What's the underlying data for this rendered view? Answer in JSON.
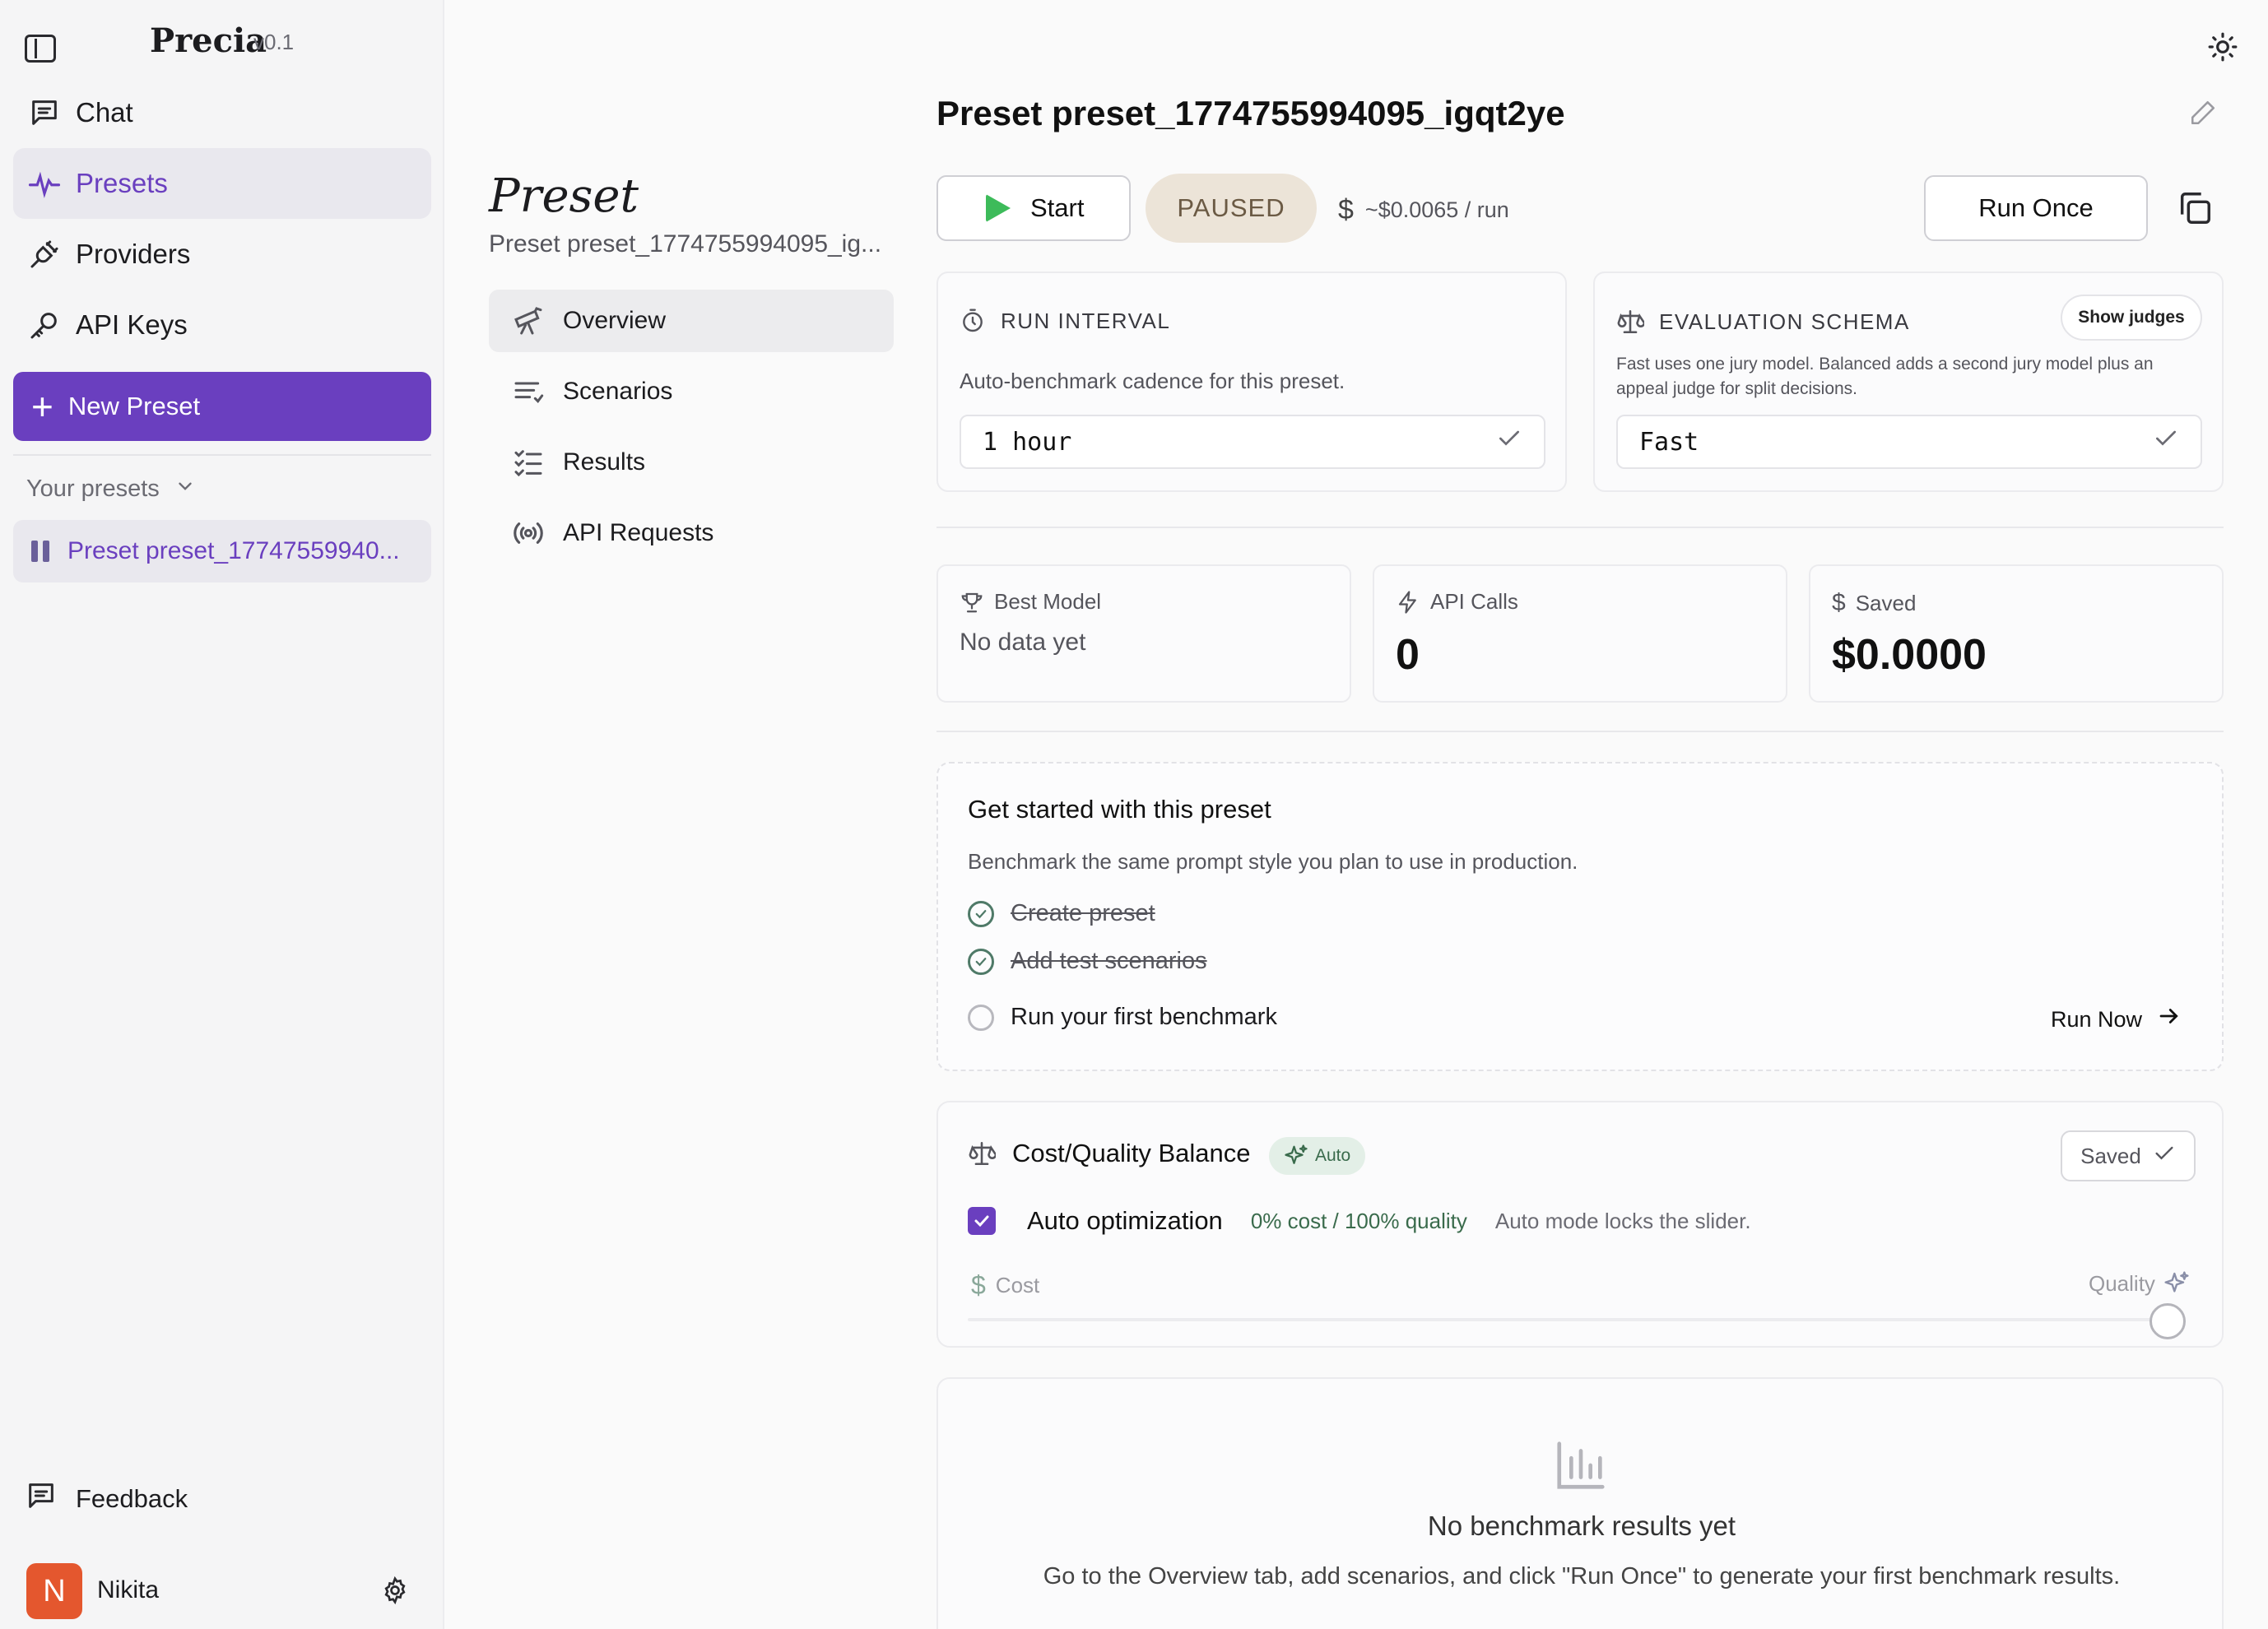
{
  "app": {
    "name": "Precia",
    "version": "v0.1"
  },
  "sidebar": {
    "nav": [
      {
        "label": "Chat",
        "icon": "chat-icon"
      },
      {
        "label": "Presets",
        "icon": "presets-icon",
        "active": true
      },
      {
        "label": "Providers",
        "icon": "plug-icon"
      },
      {
        "label": "API Keys",
        "icon": "key-icon"
      }
    ],
    "new_preset_label": "New Preset",
    "your_presets_label": "Your presets",
    "presets": [
      {
        "label": "Preset preset_17747559940..."
      }
    ],
    "feedback_label": "Feedback",
    "user": {
      "initial": "N",
      "name": "Nikita"
    }
  },
  "middle": {
    "title": "Preset",
    "subtitle": "Preset preset_1774755994095_ig...",
    "tabs": [
      {
        "label": "Overview",
        "icon": "telescope-icon",
        "active": true
      },
      {
        "label": "Scenarios",
        "icon": "list-icon"
      },
      {
        "label": "Results",
        "icon": "checklist-icon"
      },
      {
        "label": "API Requests",
        "icon": "broadcast-icon"
      }
    ]
  },
  "main": {
    "title": "Preset preset_1774755994095_igqt2ye",
    "toolbar": {
      "start_label": "Start",
      "status": "PAUSED",
      "cost_per_run": "~$0.0065 / run",
      "run_once_label": "Run Once"
    },
    "run_interval": {
      "heading": "RUN INTERVAL",
      "description": "Auto-benchmark cadence for this preset.",
      "value": "1 hour"
    },
    "evaluation_schema": {
      "heading": "EVALUATION SCHEMA",
      "show_judges_label": "Show judges",
      "description": "Fast uses one jury model. Balanced adds a second jury model plus an appeal judge for split decisions.",
      "value": "Fast"
    },
    "stats": {
      "best_model": {
        "label": "Best Model",
        "value": "No data yet"
      },
      "api_calls": {
        "label": "API Calls",
        "value": "0"
      },
      "saved": {
        "label": "Saved",
        "value": "$0.0000"
      }
    },
    "get_started": {
      "title": "Get started with this preset",
      "subtitle": "Benchmark the same prompt style you plan to use in production.",
      "steps": [
        {
          "label": "Create preset",
          "done": true
        },
        {
          "label": "Add test scenarios",
          "done": true
        },
        {
          "label": "Run your first benchmark",
          "done": false
        }
      ],
      "run_now_label": "Run Now"
    },
    "cost_quality": {
      "title": "Cost/Quality Balance",
      "badge": "Auto",
      "saved_label": "Saved",
      "auto_optimization_label": "Auto optimization",
      "auto_optimization_checked": true,
      "ratio": "0% cost / 100% quality",
      "note": "Auto mode locks the slider.",
      "cost_label": "Cost",
      "quality_label": "Quality",
      "slider_quality_fraction": 1.0
    },
    "empty_state": {
      "title": "No benchmark results yet",
      "message": "Go to the Overview tab, add scenarios, and click \"Run Once\" to generate your first benchmark results."
    }
  },
  "colors": {
    "accent": "#6a3fbf",
    "start_green": "#3dbb5a",
    "paused_bg": "#ece4d8",
    "auto_badge_bg": "#e3efe7",
    "avatar": "#e4572e"
  }
}
